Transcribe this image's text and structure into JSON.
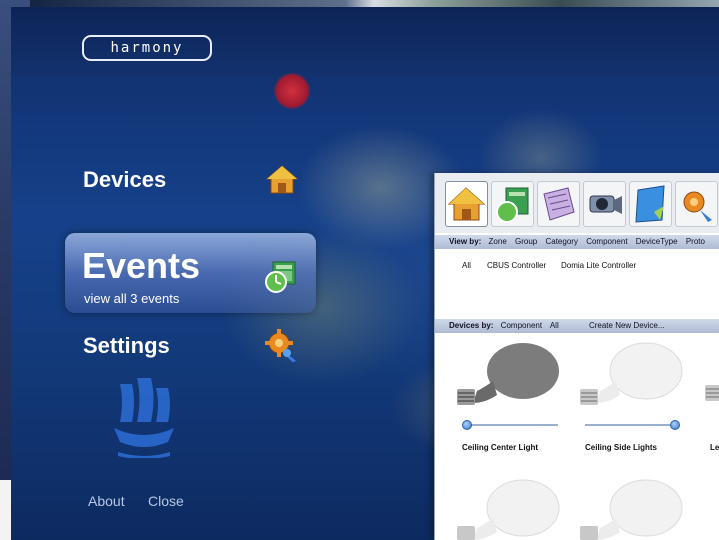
{
  "app": {
    "logo_text": "harmony"
  },
  "menu": {
    "devices_label": "Devices",
    "events_label": "Events",
    "events_subtitle": "view all 3 events",
    "settings_label": "Settings"
  },
  "footer": {
    "about_label": "About",
    "close_label": "Close"
  },
  "device_window": {
    "toolbar_icons": [
      "house-icon",
      "event-icon",
      "scene-icon",
      "camera-icon",
      "schedule-icon",
      "settings-icon"
    ],
    "view_by": {
      "label": "View by:",
      "options": [
        "Zone",
        "Group",
        "Category",
        "Component",
        "DeviceType",
        "Proto"
      ]
    },
    "filters": [
      "All",
      "CBUS Controller",
      "Domia Lite Controller"
    ],
    "devices_by": {
      "label": "Devices by:",
      "options": [
        "Component",
        "All"
      ],
      "create_label": "Create New Device..."
    },
    "devices": [
      {
        "name": "Ceiling Center Light",
        "level": 0,
        "state": "off"
      },
      {
        "name": "Ceiling Side Lights",
        "level": 1,
        "state": "on"
      },
      {
        "name": "Le",
        "level": null,
        "state": "on"
      }
    ]
  },
  "colors": {
    "accent_blue": "#16418a",
    "menu_text": "#ffffff",
    "footer_text": "#b8c8e4"
  }
}
